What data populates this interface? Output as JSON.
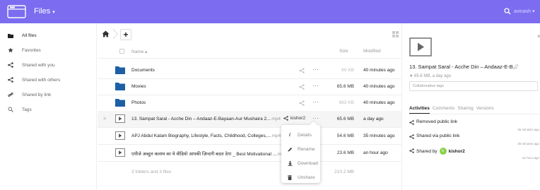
{
  "header": {
    "app_name": "Files",
    "caret": "▾",
    "username": "avinash ▾",
    "accent": "#7c6cf0"
  },
  "sidebar": {
    "items": [
      {
        "label": "All files",
        "icon": "folder-icon",
        "active": true
      },
      {
        "label": "Favorites",
        "icon": "star-icon"
      },
      {
        "label": "Shared with you",
        "icon": "share-icon"
      },
      {
        "label": "Shared with others",
        "icon": "share-icon"
      },
      {
        "label": "Shared by link",
        "icon": "link-icon"
      },
      {
        "label": "Tags",
        "icon": "tag-icon"
      }
    ]
  },
  "toolbar": {
    "add_label": "+"
  },
  "table": {
    "headers": {
      "name": "Name ▴",
      "size": "Size",
      "modified": "Modified"
    },
    "rows": [
      {
        "type": "folder",
        "name": "Documents",
        "ext": "",
        "size": "60 KB",
        "size_light": true,
        "modified": "40 minutes ago"
      },
      {
        "type": "folder",
        "name": "Movies",
        "ext": "",
        "size": "65.6 MB",
        "modified": "40 minutes ago"
      },
      {
        "type": "folder",
        "name": "Photos",
        "ext": "",
        "size": "663 KB",
        "size_light": true,
        "modified": "40 minutes ago"
      },
      {
        "type": "video",
        "name": "13. Sampat Saral - Acche Din – Andaaz-E-Bayaan-Aur Mushaira 2...",
        "ext": ".mp4",
        "shared_with": "kishor2",
        "size": "65.6 MB",
        "modified": "a day ago",
        "highlight": true
      },
      {
        "type": "video",
        "name": "APJ Abdul Kalam Biography, Lifestyle, Facts, Childhood, Colleges,...",
        "ext": ".mp4",
        "size": "54.6 MB",
        "modified": "35 minutes ago"
      },
      {
        "type": "video",
        "name": "एपीजे अब्दुल कलाम का ये वीडियो आपकी ज़िन्दगी बदल देगा _ Best Motivational ...",
        "ext": ".mp4",
        "size": "23.6 MB",
        "modified": "an hour ago"
      }
    ],
    "summary": "3 folders and 3 files",
    "summary_size": "210.2 MB"
  },
  "menu": {
    "items": [
      {
        "label": "Details",
        "icon": "info-icon"
      },
      {
        "label": "Rename",
        "icon": "pencil-icon"
      },
      {
        "label": "Download",
        "icon": "download-icon"
      },
      {
        "label": "Unshare",
        "icon": "trash-icon"
      }
    ]
  },
  "details": {
    "title": "13. Sampat Saral - Acche Din – Andaaz-E-B...",
    "meta": "★ 65.6 MB, a day ago",
    "tags_placeholder": "Collaborative tags",
    "tabs": [
      "Activities",
      "Comments",
      "Sharing",
      "Versions"
    ],
    "activities": [
      {
        "text": "Removed public link",
        "time": "36 minutes ago"
      },
      {
        "text": "Shared via public link",
        "time": "36 minutes ago"
      },
      {
        "text_pre": "Shared by",
        "avatar_letter": "k",
        "user": "kishor2",
        "time": "an hour ago"
      }
    ]
  }
}
